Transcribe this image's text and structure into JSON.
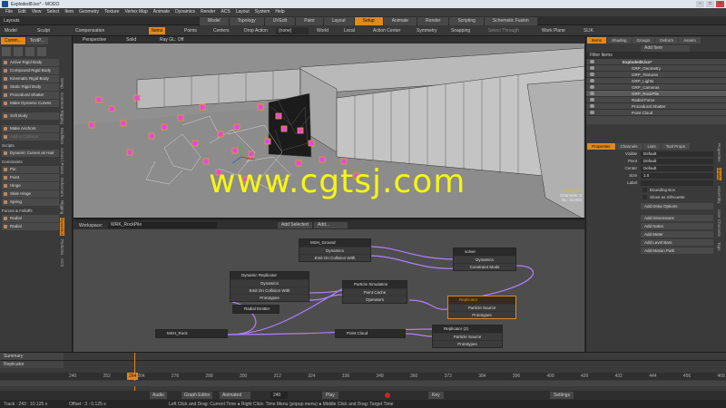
{
  "window": {
    "title": "Exploded8.lxo* - MODO"
  },
  "menu": [
    "File",
    "Edit",
    "View",
    "Select",
    "Item",
    "Geometry",
    "Texture",
    "Vertex Map",
    "Animate",
    "Dynamics",
    "Render",
    "ACS",
    "Layout",
    "System",
    "Help"
  ],
  "layout_label": "Layouts",
  "layout_tabs": [
    "Model",
    "Topology",
    "UVEdit",
    "Paint",
    "Layout",
    "Setup",
    "Animate",
    "Render",
    "Scripting",
    "Schematic Fusion"
  ],
  "active_layout_tab": "Setup",
  "toolbar": {
    "model": "Model",
    "sculpt": "Sculpt",
    "compensation": "Compensation",
    "items": "Items",
    "points": "Points",
    "centers": "Centers",
    "drop_action": "Drop Action",
    "drop_action_value": "(none)",
    "world": "World",
    "local": "Local",
    "action_center": "Action Center",
    "symmetry": "Symmetry",
    "snapping": "Snapping",
    "select_through": "Select Through",
    "work_plane": "Work Plane",
    "slik": "SLIK"
  },
  "left_panel": {
    "tabs": [
      "Comm...",
      "TextP..."
    ],
    "vertical_tabs": [
      "Setup",
      "Common Rigging",
      "Modifiers",
      "Actors / Poses",
      "Deformers",
      "Rigging",
      "Dynamics",
      "Particles",
      "ACS"
    ],
    "active_vertical_tab": "Dynamics",
    "rigid_body_buttons": [
      "Active Rigid Body",
      "Compound Rigid Body",
      "Kinematic Rigid Body",
      "Static Rigid Body",
      "Procedural Shatter",
      "Make Dynamic Curves"
    ],
    "soft_body": "Soft Body",
    "anchor_buttons": [
      "Make Anchors",
      "Add to Collision"
    ],
    "scripts_header": "Scripts",
    "scripts_button": "Dynamic Curves as Hair",
    "constraints_header": "Constraints",
    "constraints": [
      "Pin",
      "Point",
      "Hinge",
      "Slide Hinge",
      "Spring"
    ],
    "forces_header": "Forces & Falloffs",
    "forces": [
      "Radial",
      "Radial"
    ]
  },
  "viewport": {
    "view": "Perspective",
    "shading": "Solid",
    "renderer": "Ray GL: Off",
    "info_lines": [
      "Replicator",
      "Channels: 0",
      "GL: 31,002"
    ]
  },
  "node_bar": {
    "workspace_label": "Workspace:",
    "workspace_value": "WRK_RockPile",
    "add_selected": "Add Selected",
    "add": "Add..."
  },
  "nodes": [
    {
      "title": "MSH_Ground",
      "rows": [
        "Dynamics",
        "Emit On Collision With"
      ]
    },
    {
      "title": "solver",
      "rows": [
        "Dynamics",
        "Constraint Mods"
      ]
    },
    {
      "title": "Dynamic Replicator",
      "rows": [
        "Dynamics",
        "Emit On Collision With",
        "Prototypes"
      ]
    },
    {
      "title": "Particle Simulation",
      "rows": [
        "Point Cache",
        "Operators"
      ]
    },
    {
      "title": "Radial Emitter",
      "rows": []
    },
    {
      "title": "Replicator",
      "rows": [
        "Particle Source",
        "Prototypes"
      ]
    },
    {
      "title": "MSH_Rock",
      "rows": []
    },
    {
      "title": "Point Cloud",
      "rows": []
    },
    {
      "title": "Replicator (2)",
      "rows": [
        "Particle Source",
        "Prototypes"
      ]
    }
  ],
  "right_panel": {
    "tabs": [
      "Items",
      "Shading",
      "Groups",
      "Deform",
      "Assem"
    ],
    "add_item": "Add Item",
    "filter_items": "Filter Items",
    "items": [
      "Exploded8.lxo*",
      "GRP_Geometry",
      "GRP_Textures",
      "GRP_Lights",
      "GRP_Cameras",
      "GRP_RockPile",
      "Radial Force",
      "Procedural Shatter",
      "Point Cloud"
    ],
    "prop_tabs": [
      "Properties",
      "Channels",
      "Lists",
      "Tool Props"
    ],
    "properties": [
      {
        "label": "Visible",
        "value": "Default"
      },
      {
        "label": "Pivot",
        "value": "Default"
      },
      {
        "label": "Center",
        "value": "Default"
      },
      {
        "label": "Size",
        "value": "1.0"
      },
      {
        "label": "Label",
        "value": ""
      }
    ],
    "bounding_box": "Bounding Box",
    "show_as_silhouette": "Show as Silhouette",
    "buttons": [
      "Add Draw Options",
      "Add Dimensions",
      "Add Notes",
      "Add Meter",
      "Add Level Bars",
      "Add Motion Path"
    ],
    "side_tabs": [
      "Properties",
      "Display",
      "Assembly",
      "User Channels",
      "Tags"
    ]
  },
  "timeline": {
    "summary": "Summary",
    "track": "Replicator",
    "ticks": [
      "240",
      "252",
      "264",
      "276",
      "288",
      "300",
      "312",
      "324",
      "336",
      "348",
      "360",
      "372",
      "384",
      "396",
      "408",
      "420",
      "432",
      "444",
      "456",
      "468"
    ],
    "current_frame": "264"
  },
  "transport": {
    "audio": "Audio",
    "graph_editor": "Graph Editor",
    "animated": "Animated",
    "frame": "240",
    "play": "Play",
    "key": "Key",
    "settings": "Settings"
  },
  "status": {
    "left": "Track : 243 : 10.125 s",
    "offset": "Offset : 3 : 0.125 s",
    "hint": "Left Click and Drag: Current Time  ●  Right Click: Time Menu (popup menu)  ●  Middle Click and Drag: Target Time"
  },
  "watermark": "www.cgtsj.com",
  "colors": {
    "accent": "#e0891c",
    "viewport_bg": "#909090",
    "wire_purple": "#b47cff",
    "watermark": "#f5f513"
  }
}
